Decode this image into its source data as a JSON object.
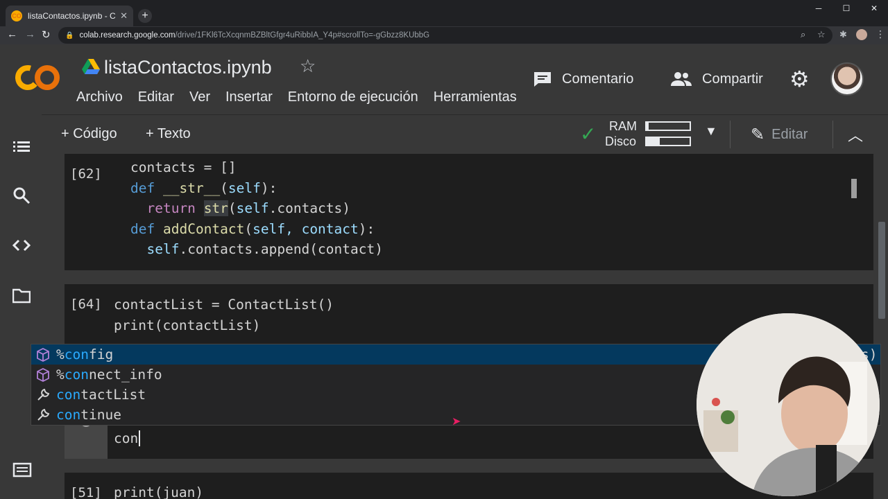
{
  "browser": {
    "tab_title": "listaContactos.ipynb - Colaborato",
    "tab_favicon": "CO",
    "new_tab": "+",
    "url_host": "colab.research.google.com",
    "url_path": "/drive/1FKl6TcXcqnmBZBltGfgr4uRibbIA_Y4p#scrollTo=-gGbzz8KUbbG",
    "window_controls": [
      "─",
      "☐",
      "✕"
    ]
  },
  "colab": {
    "notebook_title": "listaContactos.ipynb",
    "menu": [
      "Archivo",
      "Editar",
      "Ver",
      "Insertar",
      "Entorno de ejecución",
      "Herramientas"
    ],
    "comment_label": "Comentario",
    "share_label": "Compartir",
    "toolbar": {
      "add_code": "+ Código",
      "add_text": "+ Texto",
      "ram_label": "RAM",
      "disk_label": "Disco",
      "ram_fraction": 0.05,
      "disk_fraction": 0.3,
      "edit_label": "Editar"
    }
  },
  "cells": [
    {
      "exec_count": "[62]",
      "lines": [
        "contacts = []",
        "def __str__(self):",
        "  return str(self.contacts)",
        "def addContact(self, contact):",
        "  self.contacts.append(contact)"
      ]
    },
    {
      "exec_count": "[64]",
      "lines": [
        "contactList = ContactList()",
        "print(contactList)"
      ],
      "trailing": "s)"
    },
    {
      "exec_count": "",
      "lines": [
        "con"
      ]
    },
    {
      "exec_count": "[51]",
      "lines": [
        "print(juan)"
      ]
    }
  ],
  "autocomplete": {
    "items": [
      {
        "prefix": "%",
        "match": "con",
        "rest": "fig",
        "icon": "cube-icon"
      },
      {
        "prefix": "%",
        "match": "con",
        "rest": "nect_info",
        "icon": "cube-icon"
      },
      {
        "prefix": "",
        "match": "con",
        "rest": "tactList",
        "icon": "wrench-icon"
      },
      {
        "prefix": "",
        "match": "con",
        "rest": "tinue",
        "icon": "wrench-icon"
      }
    ]
  },
  "colors": {
    "accent_match": "#2aaaff",
    "keyword": "#569cd6",
    "check": "#34a853",
    "selection": "#04395e"
  }
}
